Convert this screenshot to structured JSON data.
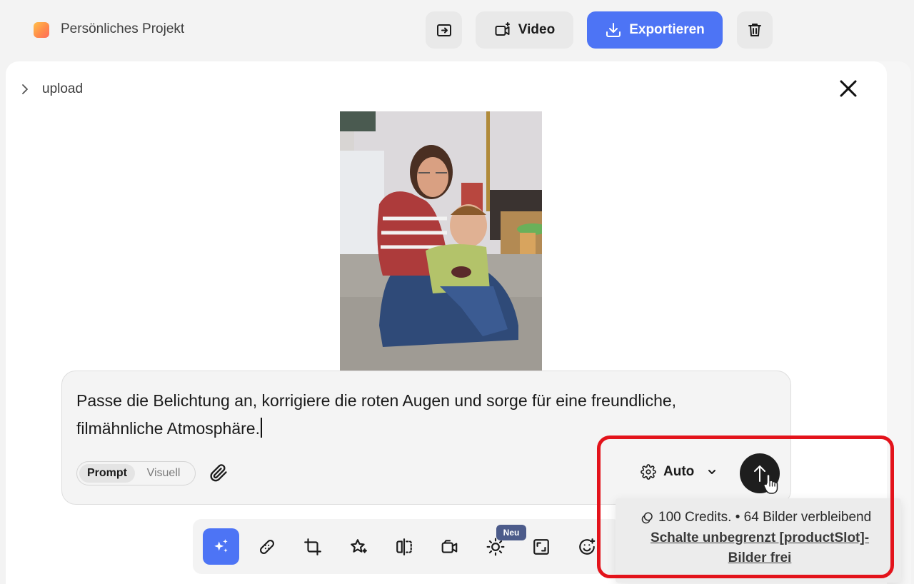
{
  "header": {
    "project_name": "Persönliches Projekt",
    "video_label": "Video",
    "export_label": "Exportieren",
    "accent_color": "#4d74f5"
  },
  "breadcrumb": {
    "label": "upload"
  },
  "photo": {
    "alt": "Frau mit Kind auf dem Boden sitzend"
  },
  "prompt": {
    "text": "Passe die Belichtung an, korrigiere die roten Augen und sorge für eine freundliche, filmähnliche Atmosphäre.",
    "modes": [
      "Prompt",
      "Visuell"
    ],
    "active_mode": "Prompt",
    "model_selector": "Auto"
  },
  "toolbar": {
    "tools": [
      "magic-edit",
      "heal",
      "crop",
      "enhance",
      "mirror",
      "video",
      "light",
      "expand",
      "face"
    ],
    "active_tool": "magic-edit",
    "new_badge": "Neu"
  },
  "credits": {
    "summary": "100 Credits. • 64 Bilder verbleibend",
    "upgrade_link": "Schalte unbegrenzt [productSlot]-Bilder frei"
  },
  "highlight_color": "#e3131b"
}
